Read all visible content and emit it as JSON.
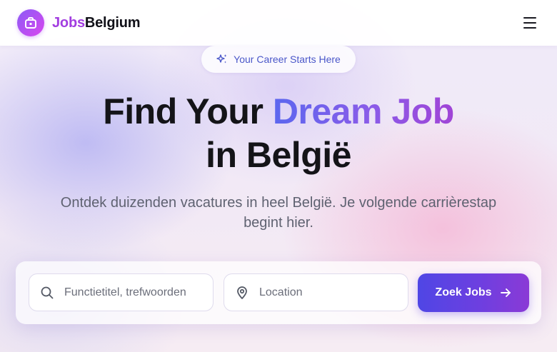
{
  "header": {
    "brand_part1": "Jobs",
    "brand_part2": "Belgium",
    "menu_icon": "hamburger-menu-icon",
    "logo_icon": "briefcase-icon"
  },
  "hero": {
    "badge_text": "Your Career Starts Here",
    "badge_icon": "sparkles-icon",
    "title_part1": "Find Your ",
    "title_highlight": "Dream Job",
    "title_part2": "in België",
    "subtitle": "Ontdek duizenden vacatures in heel België. Je volgende carrièrestap begint hier."
  },
  "search": {
    "keyword_placeholder": "Functietitel, trefwoorden",
    "keyword_icon": "search-icon",
    "location_placeholder": "Location",
    "location_icon": "map-pin-icon",
    "button_label": "Zoek Jobs",
    "button_icon": "arrow-right-icon"
  },
  "colors": {
    "brand_purple": "#a23de0",
    "accent_indigo": "#4f46e5",
    "accent_violet": "#8a3ad6",
    "badge_text": "#4a57c9"
  }
}
